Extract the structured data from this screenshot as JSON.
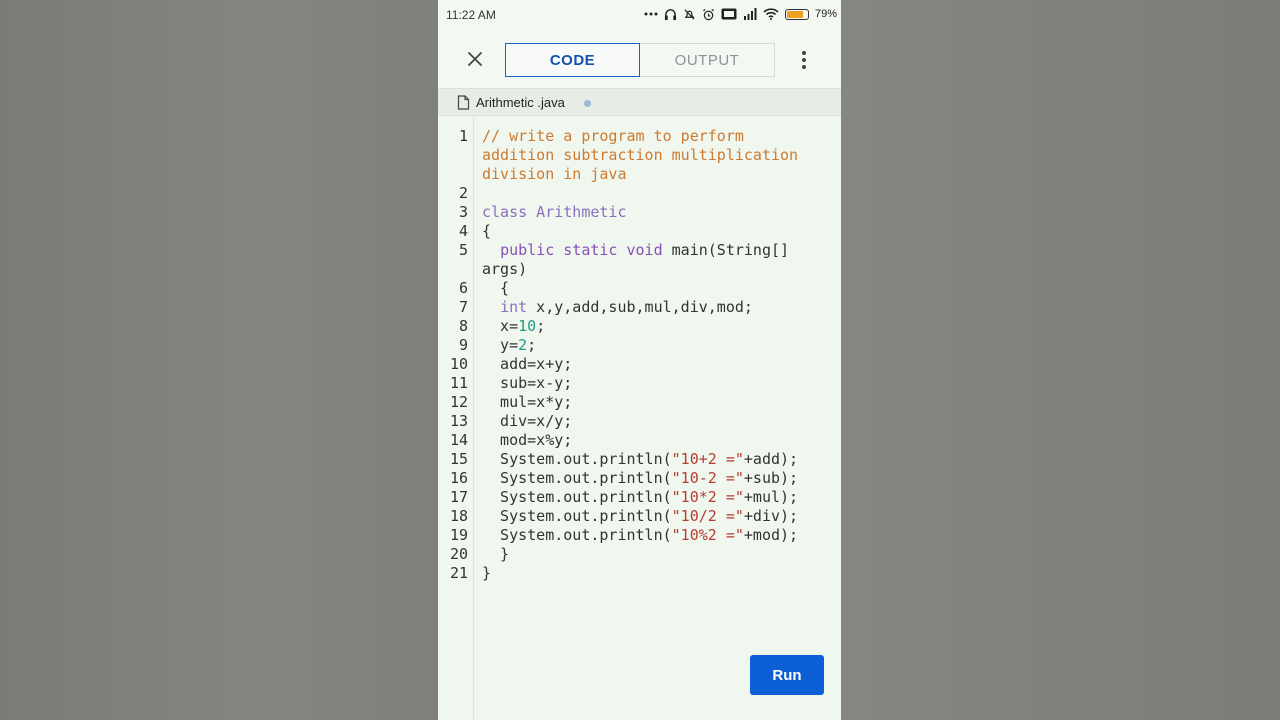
{
  "status_bar": {
    "time": "11:22 AM",
    "battery_percent": "79%",
    "battery_color": "#f0a020",
    "icons": [
      "more-dots-icon",
      "headphones-icon",
      "mute-bell-icon",
      "alarm-icon",
      "volte-icon",
      "signal-icon",
      "wifi-icon",
      "battery-icon"
    ]
  },
  "app_bar": {
    "tabs": [
      {
        "label": "CODE",
        "active": true
      },
      {
        "label": "OUTPUT",
        "active": false
      }
    ],
    "accent_color": "#1560c8"
  },
  "file": {
    "name": "Arithmetic .java"
  },
  "editor": {
    "lines": [
      {
        "n": "1",
        "row": 0,
        "text": "// write a program to perform",
        "tokens": [
          [
            "comment",
            "// write a program to perform"
          ]
        ]
      },
      {
        "n": "",
        "row": 1,
        "tokens": [
          [
            "comment",
            "addition subtraction multiplication"
          ]
        ]
      },
      {
        "n": "",
        "row": 2,
        "tokens": [
          [
            "comment",
            "division in java"
          ]
        ]
      },
      {
        "n": "2",
        "row": 3,
        "tokens": []
      },
      {
        "n": "3",
        "row": 4,
        "tokens": [
          [
            "type",
            "class Arithmetic"
          ]
        ]
      },
      {
        "n": "4",
        "row": 5,
        "tokens": [
          [
            "plain",
            "{"
          ]
        ]
      },
      {
        "n": "5",
        "row": 6,
        "tokens": [
          [
            "plain",
            "  "
          ],
          [
            "keyword",
            "public static void"
          ],
          [
            "plain",
            " main(String[]"
          ]
        ]
      },
      {
        "n": "",
        "row": 7,
        "tokens": [
          [
            "plain",
            "args)"
          ]
        ]
      },
      {
        "n": "6",
        "row": 8,
        "tokens": [
          [
            "plain",
            "  {"
          ]
        ]
      },
      {
        "n": "7",
        "row": 9,
        "tokens": [
          [
            "plain",
            "  "
          ],
          [
            "type",
            "int"
          ],
          [
            "plain",
            " x,y,add,sub,mul,div,mod;"
          ]
        ]
      },
      {
        "n": "8",
        "row": 10,
        "tokens": [
          [
            "plain",
            "  x="
          ],
          [
            "number",
            "10"
          ],
          [
            "plain",
            ";"
          ]
        ]
      },
      {
        "n": "9",
        "row": 11,
        "tokens": [
          [
            "plain",
            "  y="
          ],
          [
            "number",
            "2"
          ],
          [
            "plain",
            ";"
          ]
        ]
      },
      {
        "n": "10",
        "row": 12,
        "tokens": [
          [
            "plain",
            "  add=x+y;"
          ]
        ]
      },
      {
        "n": "11",
        "row": 13,
        "tokens": [
          [
            "plain",
            "  sub=x-y;"
          ]
        ]
      },
      {
        "n": "12",
        "row": 14,
        "tokens": [
          [
            "plain",
            "  mul=x*y;"
          ]
        ]
      },
      {
        "n": "13",
        "row": 15,
        "tokens": [
          [
            "plain",
            "  div=x/y;"
          ]
        ]
      },
      {
        "n": "14",
        "row": 16,
        "tokens": [
          [
            "plain",
            "  mod=x%y;"
          ]
        ]
      },
      {
        "n": "15",
        "row": 17,
        "tokens": [
          [
            "plain",
            "  System.out.println("
          ],
          [
            "string",
            "\"10+2 =\""
          ],
          [
            "plain",
            "+add);"
          ]
        ]
      },
      {
        "n": "16",
        "row": 18,
        "tokens": [
          [
            "plain",
            "  System.out.println("
          ],
          [
            "string",
            "\"10-2 =\""
          ],
          [
            "plain",
            "+sub);"
          ]
        ]
      },
      {
        "n": "17",
        "row": 19,
        "tokens": [
          [
            "plain",
            "  System.out.println("
          ],
          [
            "string",
            "\"10*2 =\""
          ],
          [
            "plain",
            "+mul);"
          ]
        ]
      },
      {
        "n": "18",
        "row": 20,
        "tokens": [
          [
            "plain",
            "  System.out.println("
          ],
          [
            "string",
            "\"10/2 =\""
          ],
          [
            "plain",
            "+div);"
          ]
        ]
      },
      {
        "n": "19",
        "row": 21,
        "tokens": [
          [
            "plain",
            "  System.out.println("
          ],
          [
            "string",
            "\"10%2 =\""
          ],
          [
            "plain",
            "+mod);"
          ]
        ]
      },
      {
        "n": "20",
        "row": 22,
        "tokens": [
          [
            "plain",
            "  }"
          ]
        ]
      },
      {
        "n": "21",
        "row": 23,
        "tokens": [
          [
            "plain",
            "}"
          ]
        ]
      }
    ]
  },
  "run_button": {
    "label": "Run",
    "color": "#0d5fd6"
  }
}
